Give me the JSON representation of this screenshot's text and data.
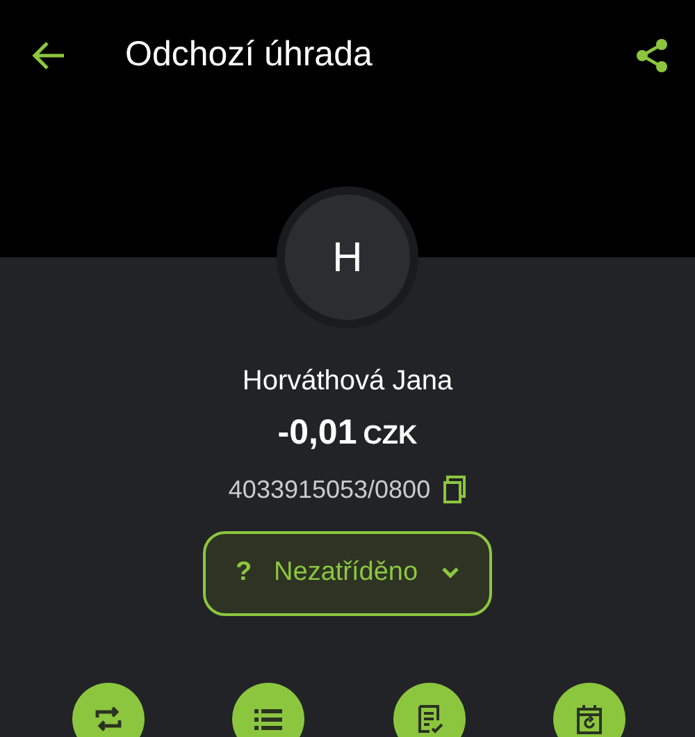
{
  "header": {
    "title": "Odchozí úhrada"
  },
  "counterparty": {
    "initial": "H",
    "name": "Horváthová Jana",
    "amount": "-0,01",
    "currency": "CZK",
    "account": "4033915053/0800"
  },
  "category": {
    "icon": "?",
    "label": "Nezatříděno"
  },
  "actions": [
    {
      "kind": "repeat"
    },
    {
      "kind": "list"
    },
    {
      "kind": "note"
    },
    {
      "kind": "calendar"
    }
  ]
}
